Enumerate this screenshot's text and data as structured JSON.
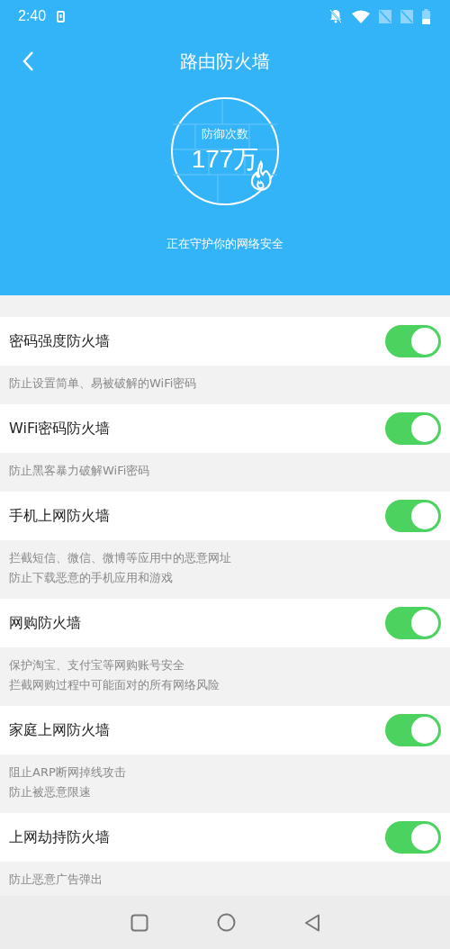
{
  "status_bar": {
    "time": "2:40"
  },
  "header": {
    "title": "路由防火墙",
    "counter_label": "防御次数",
    "counter_value": "177万",
    "caption": "正在守护你的网络安全"
  },
  "settings": [
    {
      "title": "密码强度防火墙",
      "on": true,
      "description": [
        "防止设置简单、易被破解的WiFi密码"
      ]
    },
    {
      "title": "WiFi密码防火墙",
      "on": true,
      "description": [
        "防止黑客暴力破解WiFi密码"
      ]
    },
    {
      "title": "手机上网防火墙",
      "on": true,
      "description": [
        "拦截短信、微信、微博等应用中的恶意网址",
        "防止下载恶意的手机应用和游戏"
      ]
    },
    {
      "title": "网购防火墙",
      "on": true,
      "description": [
        "保护淘宝、支付宝等网购账号安全",
        "拦截网购过程中可能面对的所有网络风险"
      ]
    },
    {
      "title": "家庭上网防火墙",
      "on": true,
      "description": [
        "阻止ARP断网掉线攻击",
        "防止被恶意限速"
      ]
    },
    {
      "title": "上网劫持防火墙",
      "on": true,
      "description": [
        "防止恶意广告弹出"
      ]
    }
  ]
}
